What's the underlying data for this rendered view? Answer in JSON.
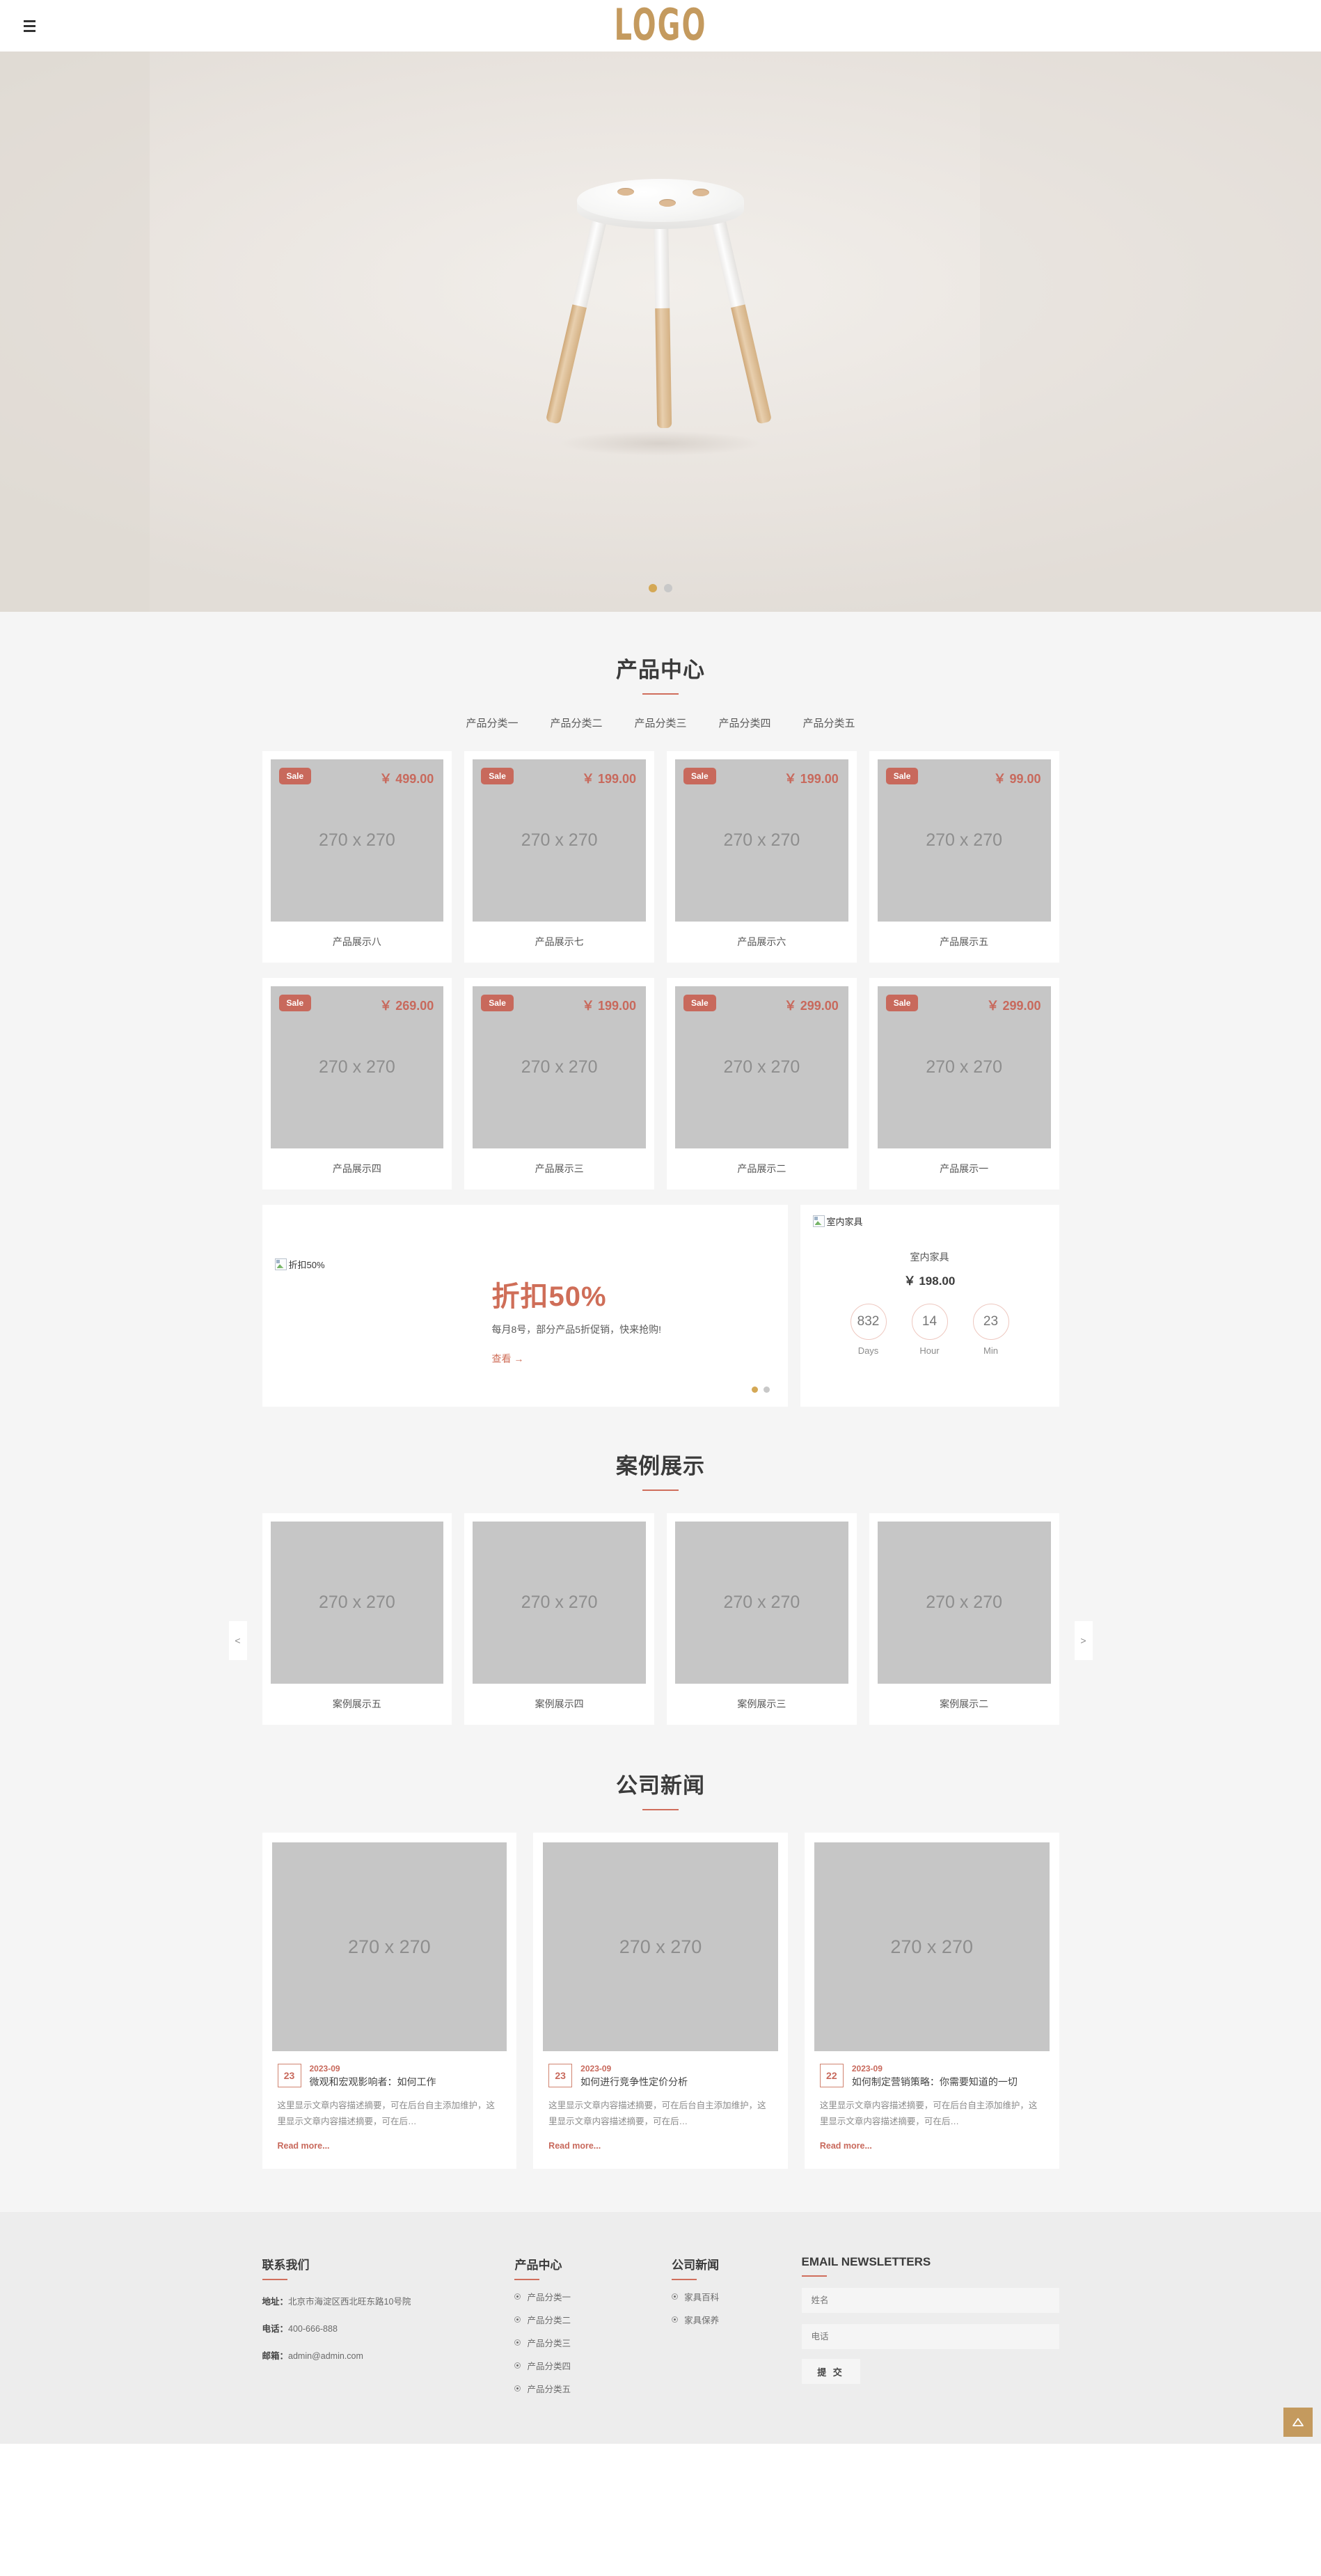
{
  "header": {
    "logo": "LOGO",
    "menu_icon": "hamburger-menu-icon"
  },
  "hero": {
    "alt": "white and wood three-legged stool",
    "dots": [
      "active",
      "inactive"
    ]
  },
  "products": {
    "title": "产品中心",
    "categories": [
      "产品分类一",
      "产品分类二",
      "产品分类三",
      "产品分类四",
      "产品分类五"
    ],
    "badge_label": "Sale",
    "placeholder": "270 x 270",
    "row1": [
      {
        "name": "产品展示八",
        "price": "￥ 499.00"
      },
      {
        "name": "产品展示七",
        "price": "￥ 199.00"
      },
      {
        "name": "产品展示六",
        "price": "￥ 199.00"
      },
      {
        "name": "产品展示五",
        "price": "￥ 99.00"
      }
    ],
    "row2": [
      {
        "name": "产品展示四",
        "price": "￥ 269.00"
      },
      {
        "name": "产品展示三",
        "price": "￥ 199.00"
      },
      {
        "name": "产品展示二",
        "price": "￥ 299.00"
      },
      {
        "name": "产品展示一",
        "price": "￥ 299.00"
      }
    ]
  },
  "promo": {
    "image_alt": "折扣50%",
    "headline": "折扣50%",
    "subtitle": "每月8号，部分产品5折促销，快来抢购!",
    "link": "查看 →",
    "dots": [
      "active",
      "inactive"
    ]
  },
  "countdown": {
    "image_alt": "室内家具",
    "title": "室内家具",
    "price": "￥ 198.00",
    "units": [
      {
        "value": "832",
        "label": "Days"
      },
      {
        "value": "14",
        "label": "Hour"
      },
      {
        "value": "23",
        "label": "Min"
      }
    ]
  },
  "cases": {
    "title": "案例展示",
    "placeholder": "270 x 270",
    "prev_label": "<",
    "next_label": ">",
    "items": [
      {
        "name": "案例展示五"
      },
      {
        "name": "案例展示四"
      },
      {
        "name": "案例展示三"
      },
      {
        "name": "案例展示二"
      }
    ]
  },
  "news": {
    "title": "公司新闻",
    "placeholder": "270 x 270",
    "read_more": "Read more...",
    "items": [
      {
        "day": "23",
        "ym": "2023-09",
        "title": "微观和宏观影响者：如何工作",
        "desc": "这里显示文章内容描述摘要，可在后台自主添加维护，这里显示文章内容描述摘要，可在后…"
      },
      {
        "day": "23",
        "ym": "2023-09",
        "title": "如何进行竞争性定价分析",
        "desc": "这里显示文章内容描述摘要，可在后台自主添加维护，这里显示文章内容描述摘要，可在后…"
      },
      {
        "day": "22",
        "ym": "2023-09",
        "title": "如何制定营销策略：你需要知道的一切",
        "desc": "这里显示文章内容描述摘要，可在后台自主添加维护，这里显示文章内容描述摘要，可在后…"
      }
    ]
  },
  "footer": {
    "contact": {
      "title": "联系我们",
      "address_label": "地址：",
      "address_value": "北京市海淀区西北旺东路10号院",
      "phone_label": "电话：",
      "phone_value": "400-666-888",
      "email_label": "邮箱：",
      "email_value": "admin@admin.com"
    },
    "products": {
      "title": "产品中心",
      "links": [
        "产品分类一",
        "产品分类二",
        "产品分类三",
        "产品分类四",
        "产品分类五"
      ]
    },
    "news": {
      "title": "公司新闻",
      "links": [
        "家具百科",
        "家具保养"
      ]
    },
    "newsletter": {
      "title": "EMAIL NEWSLETTERS",
      "name_placeholder": "姓名",
      "phone_placeholder": "电话",
      "submit_label": "提 交"
    }
  },
  "back_to_top": {
    "icon": "triangle-up-icon"
  },
  "colors": {
    "brand_gold": "#c49a5e",
    "accent_red": "#c8695c",
    "section_bg": "#f5f5f5",
    "footer_bg": "#ededed"
  }
}
